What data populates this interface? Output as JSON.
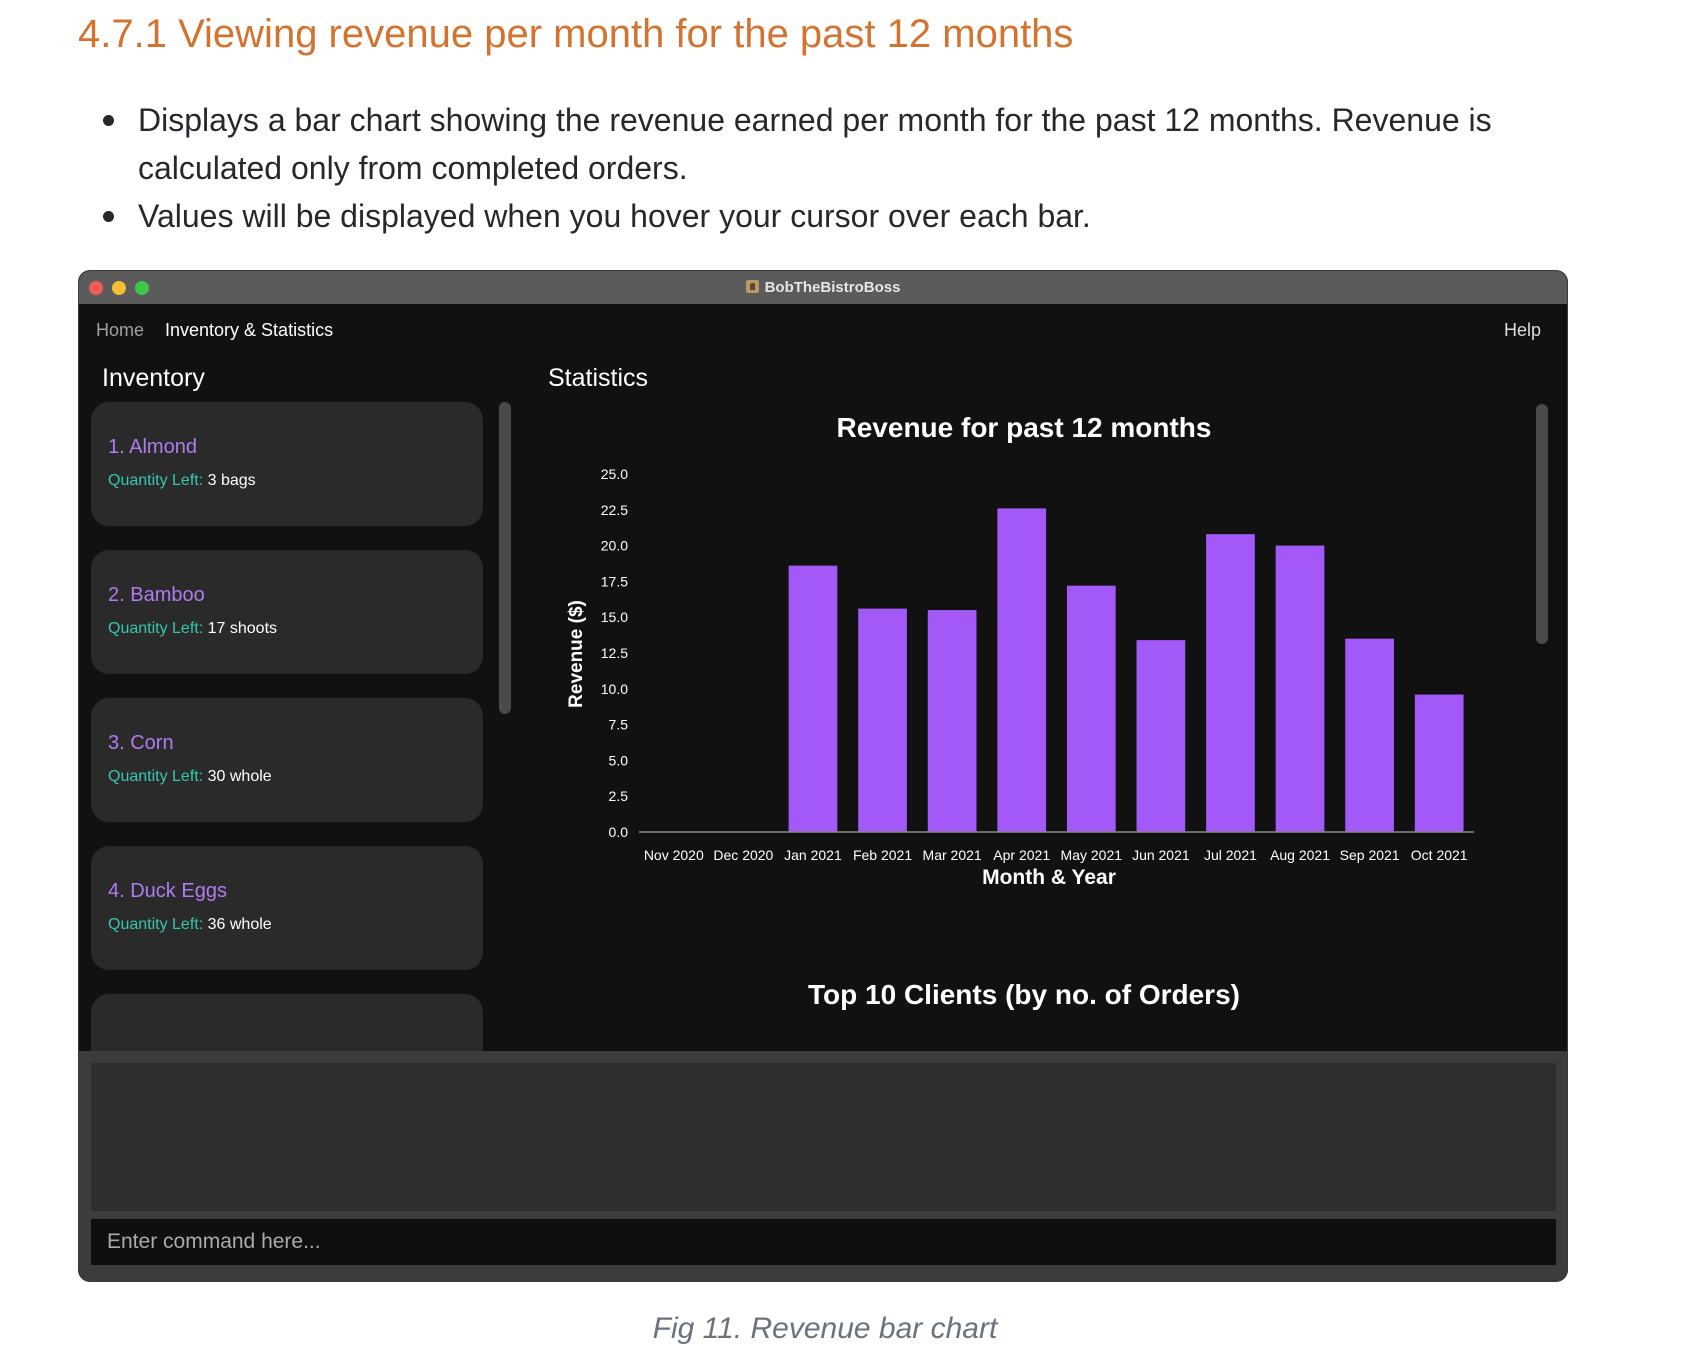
{
  "heading": "4.7.1 Viewing revenue per month for the past 12 months",
  "bullets": [
    "Displays a bar chart showing the revenue earned per month for the past 12 months. Revenue is calculated only from completed orders.",
    "Values will be displayed when you hover your cursor over each bar."
  ],
  "window": {
    "title": "BobTheBistroBoss",
    "menu": {
      "home": "Home",
      "inventory_stats": "Inventory & Statistics",
      "help": "Help"
    }
  },
  "inventory": {
    "title": "Inventory",
    "quantity_label": "Quantity Left:",
    "items": [
      {
        "name": "1.  Almond",
        "quantity": "3 bags"
      },
      {
        "name": "2.  Bamboo",
        "quantity": "17 shoots"
      },
      {
        "name": "3.  Corn",
        "quantity": "30 whole"
      },
      {
        "name": "4.  Duck Eggs",
        "quantity": "36 whole"
      }
    ]
  },
  "statistics": {
    "title": "Statistics",
    "next_chart_title": "Top 10 Clients (by no. of Orders)"
  },
  "chart_data": {
    "type": "bar",
    "title": "Revenue for past 12 months",
    "xlabel": "Month & Year",
    "ylabel": "Revenue ($)",
    "ylim": [
      0,
      25
    ],
    "yticks": [
      "0.0",
      "2.5",
      "5.0",
      "7.5",
      "10.0",
      "12.5",
      "15.0",
      "17.5",
      "20.0",
      "22.5",
      "25.0"
    ],
    "categories": [
      "Nov 2020",
      "Dec 2020",
      "Jan 2021",
      "Feb 2021",
      "Mar 2021",
      "Apr 2021",
      "May 2021",
      "Jun 2021",
      "Jul 2021",
      "Aug 2021",
      "Sep 2021",
      "Oct 2021"
    ],
    "values": [
      0,
      0,
      18.6,
      15.6,
      15.5,
      22.6,
      17.2,
      13.4,
      20.8,
      20.0,
      13.5,
      9.6
    ],
    "bar_color": "#a259f7",
    "grid": false,
    "legend": "none"
  },
  "command": {
    "placeholder": "Enter command here..."
  },
  "caption": "Fig 11. Revenue bar chart"
}
